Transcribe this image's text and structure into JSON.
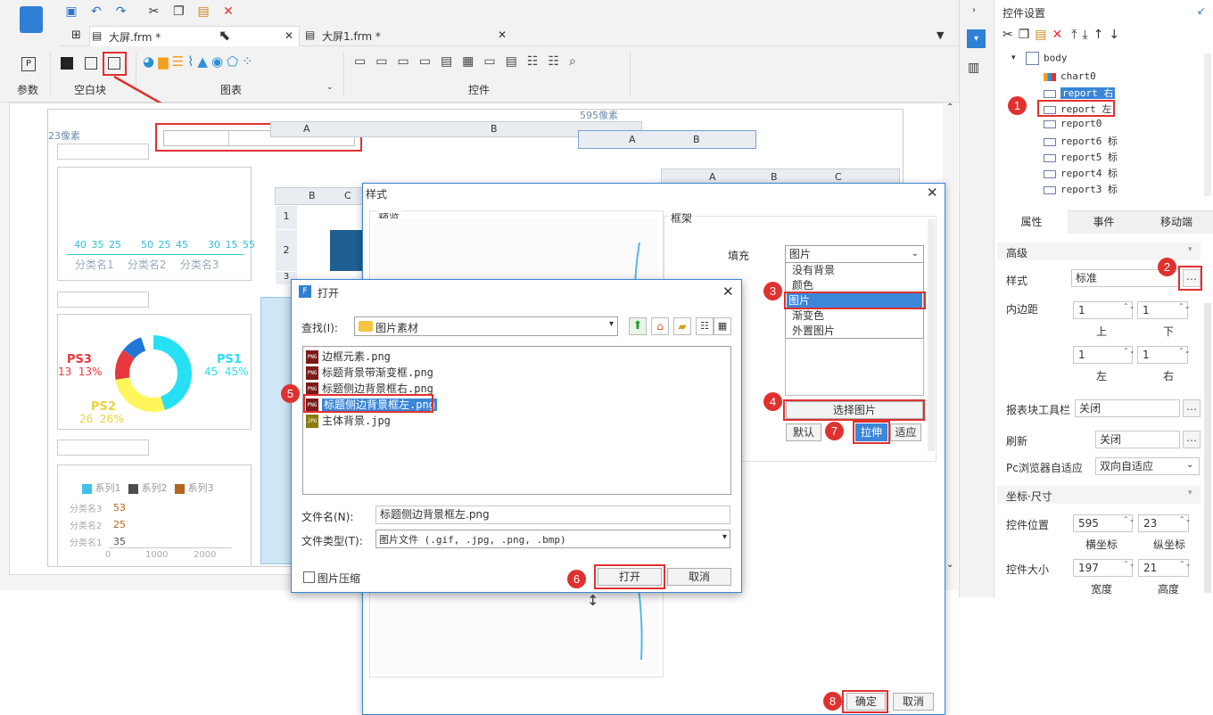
{
  "toolbar": {
    "tabs": [
      {
        "label": "大屏.frm *"
      },
      {
        "label": "大屏1.frm *"
      }
    ],
    "groups": {
      "params": "参数",
      "blank": "空白块",
      "chart": "图表",
      "widget": "控件"
    }
  },
  "canvas": {
    "label_left": "23像素",
    "label_top": "595像素",
    "table_headers_top": [
      "A",
      "B"
    ],
    "table_headers_small": [
      "A",
      "B"
    ],
    "table_headers_right": [
      "A",
      "B",
      "C"
    ],
    "table_headers_mid": [
      "B",
      "C"
    ],
    "row_numbers": [
      "1",
      "2",
      "3"
    ],
    "bar_chart": {
      "values": [
        "40",
        "35",
        "25",
        "50",
        "25",
        "45",
        "30",
        "15",
        "55"
      ],
      "categories": [
        "分类名1",
        "分类名2",
        "分类名3"
      ]
    },
    "donut": {
      "ps1_name": "PS1",
      "ps1_value": "45  45%",
      "ps2_name": "PS2",
      "ps2_value": "26  26%",
      "ps3_name": "PS3",
      "ps3_value": "13  13%"
    },
    "hbar": {
      "legend": [
        "系列1",
        "系列2",
        "系列3"
      ],
      "categories": [
        "分类名3",
        "分类名2",
        "分类名1"
      ],
      "values": [
        "53",
        "25",
        "35"
      ],
      "x_ticks": [
        "0",
        "1000",
        "2000"
      ]
    },
    "colors": {
      "cyan": "#27e0f4",
      "yellow": "#fff65b",
      "red": "#e8383d",
      "blue": "#1f78d6"
    }
  },
  "style_dialog": {
    "title": "样式",
    "preview_label": "预览",
    "frame_label": "框架",
    "fill_label": "填充",
    "fill_value": "图片",
    "fill_options": [
      "没有背景",
      "颜色",
      "图片",
      "渐变色",
      "外置图片"
    ],
    "choose_image": "选择图片",
    "modes": [
      "默认",
      "拉伸",
      "适应"
    ],
    "ok": "确定",
    "cancel": "取消"
  },
  "open_dialog": {
    "title": "打开",
    "look_in_label": "查找(I):",
    "look_in_value": "图片素材",
    "files": [
      {
        "name": "边框元素.png",
        "type": "PNG"
      },
      {
        "name": "标题背景带渐变框.png",
        "type": "PNG"
      },
      {
        "name": "标题侧边背景框右.png",
        "type": "PNG"
      },
      {
        "name": "标题侧边背景框左.png",
        "type": "PNG"
      },
      {
        "name": "主体背景.jpg",
        "type": "JPG"
      }
    ],
    "filename_label": "文件名(N):",
    "filename_value": "标题侧边背景框左.png",
    "filetype_label": "文件类型(T):",
    "filetype_value": "图片文件 (.gif, .jpg, .png, .bmp)",
    "compress": "图片压缩",
    "open": "打开",
    "cancel": "取消"
  },
  "right_panel": {
    "title": "控件设置",
    "tree": [
      "body",
      "chart0",
      "report 右",
      "report 左",
      "report0",
      "report6 标",
      "report5 标",
      "report4 标",
      "report3 标"
    ],
    "tabs": [
      "属性",
      "事件",
      "移动端"
    ],
    "advanced": "高级",
    "style_label": "样式",
    "style_value": "标准",
    "padding_label": "内边距",
    "padding": {
      "top": "1",
      "bottom": "1",
      "left": "1",
      "right": "1"
    },
    "padding_names": {
      "top": "上",
      "bottom": "下",
      "left": "左",
      "right": "右"
    },
    "report_toolbar_label": "报表块工具栏",
    "report_toolbar_value": "关闭",
    "refresh_label": "刷新",
    "refresh_value": "关闭",
    "pc_adapt_label": "Pc浏览器自适应",
    "pc_adapt_value": "双向自适应",
    "coord_section": "坐标·尺寸",
    "position_label": "控件位置",
    "position": {
      "x": "595",
      "y": "23"
    },
    "position_names": {
      "x": "横坐标",
      "y": "纵坐标"
    },
    "size_label": "控件大小",
    "size": {
      "w": "197",
      "h": "21"
    },
    "size_names": {
      "w": "宽度",
      "h": "高度"
    }
  },
  "badges": [
    "1",
    "2",
    "3",
    "4",
    "5",
    "6",
    "7",
    "8"
  ]
}
